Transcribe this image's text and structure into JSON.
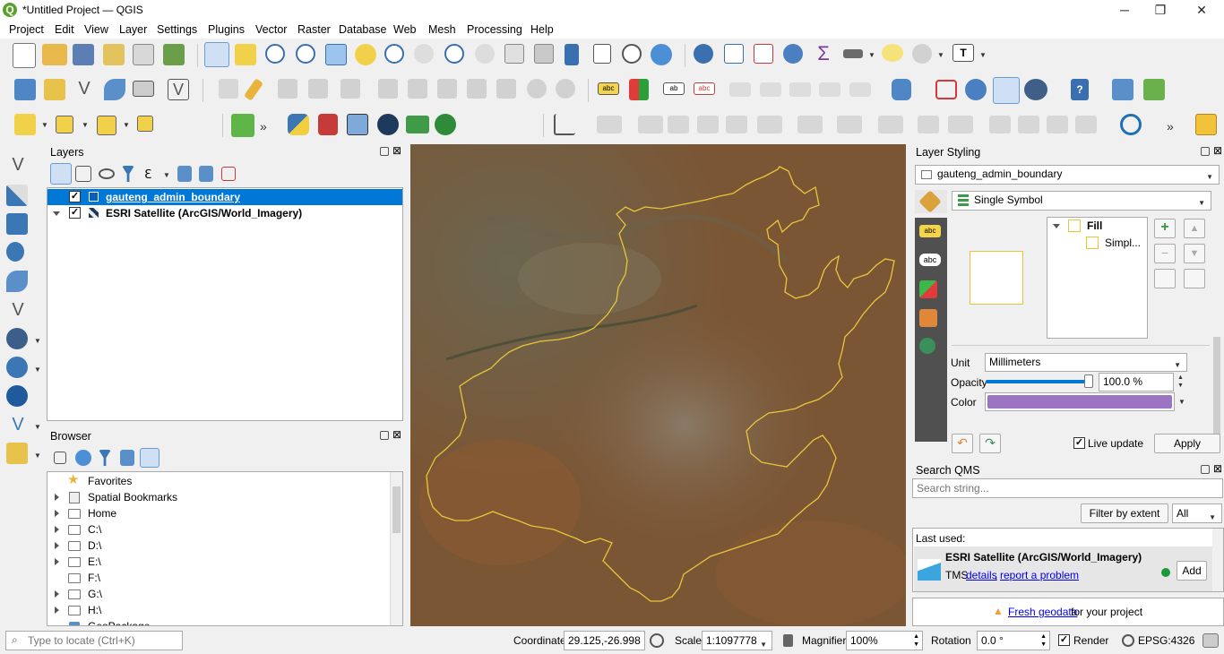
{
  "window": {
    "title": "*Untitled Project — QGIS",
    "minimize": "─",
    "maximize": "❐",
    "close": "✕"
  },
  "menu": [
    "Project",
    "Edit",
    "View",
    "Layer",
    "Settings",
    "Plugins",
    "Vector",
    "Raster",
    "Database",
    "Web",
    "Mesh",
    "Processing",
    "Help"
  ],
  "layers_panel": {
    "title": "Layers",
    "items": [
      {
        "name": "gauteng_admin_boundary",
        "checked": true,
        "selected": true
      },
      {
        "name": "ESRI Satellite (ArcGIS/World_Imagery)",
        "checked": true,
        "selected": false
      }
    ]
  },
  "browser_panel": {
    "title": "Browser",
    "items": [
      "Favorites",
      "Spatial Bookmarks",
      "Home",
      "C:\\",
      "D:\\",
      "E:\\",
      "F:\\",
      "G:\\",
      "H:\\",
      "GeoPackage"
    ]
  },
  "styling": {
    "title": "Layer Styling",
    "layer": "gauteng_admin_boundary",
    "renderer": "Single Symbol",
    "tree": {
      "fill": "Fill",
      "simple": "Simpl..."
    },
    "unit_label": "Unit",
    "unit": "Millimeters",
    "opacity_label": "Opacity",
    "opacity": "100.0 %",
    "color_label": "Color",
    "color_value": "#9b75c4",
    "live_update": "Live update",
    "live_checked": true,
    "apply": "Apply"
  },
  "qms": {
    "title": "Search QMS",
    "placeholder": "Search string...",
    "filter_btn": "Filter by extent",
    "filter_select": "All",
    "last_used": "Last used:",
    "entry_name": "ESRI Satellite (ArcGIS/World_Imagery)",
    "entry_type": "TMS",
    "details": "details",
    "report": "report a problem",
    "add": "Add",
    "footer_link": "Fresh geodata",
    "footer_text": " for your project"
  },
  "status": {
    "locate_placeholder": "Type to locate (Ctrl+K)",
    "coord_label": "Coordinate",
    "coord": "29.125,-26.998",
    "scale_label": "Scale",
    "scale": "1:1097778",
    "magnifier_label": "Magnifier",
    "magnifier": "100%",
    "rotation_label": "Rotation",
    "rotation": "0.0 °",
    "render": "Render",
    "crs": "EPSG:4326"
  },
  "colors": {
    "selection": "#0078d7",
    "boundary": "#e8c63a",
    "link": "#0000ee"
  }
}
